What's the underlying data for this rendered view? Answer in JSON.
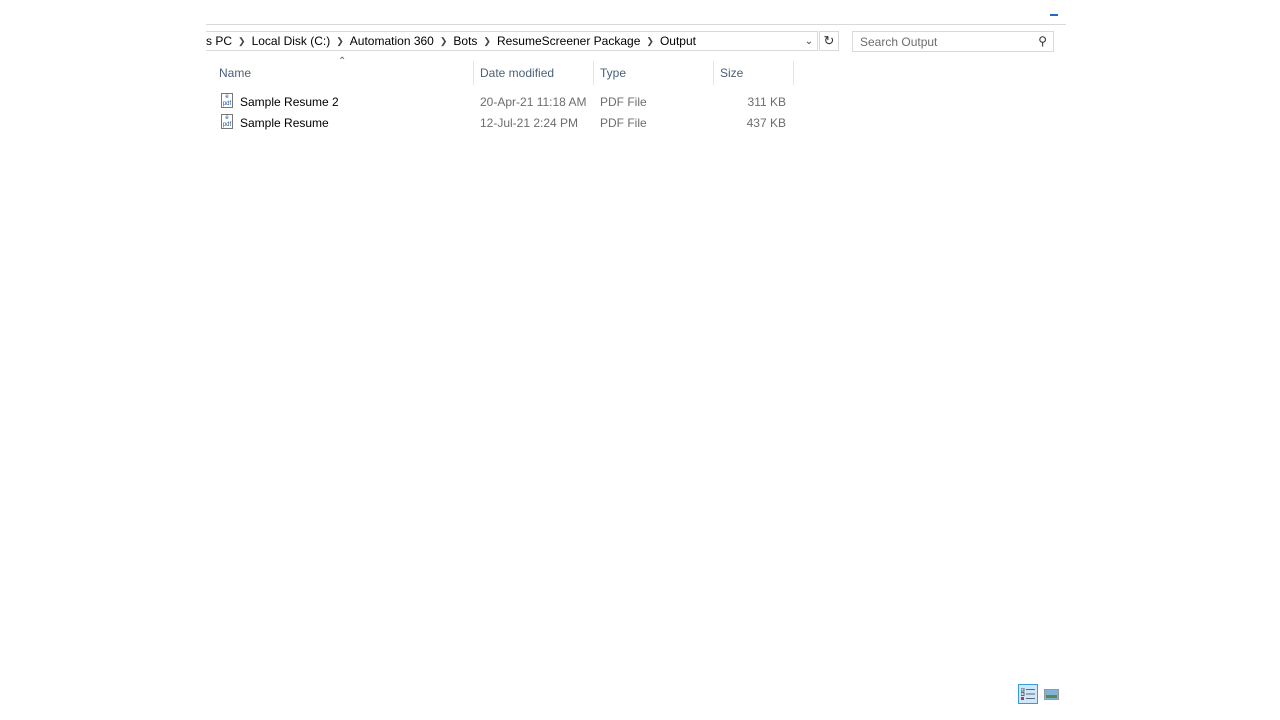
{
  "breadcrumb": [
    "s PC",
    "Local Disk (C:)",
    "Automation 360",
    "Bots",
    "ResumeScreener Package",
    "Output"
  ],
  "search": {
    "placeholder": "Search Output"
  },
  "columns": {
    "name": "Name",
    "date": "Date modified",
    "type": "Type",
    "size": "Size"
  },
  "files": [
    {
      "name": "Sample Resume 2",
      "date": "20-Apr-21 11:18 AM",
      "type": "PDF File",
      "size": "311 KB"
    },
    {
      "name": "Sample Resume",
      "date": "12-Jul-21 2:24 PM",
      "type": "PDF File",
      "size": "437 KB"
    }
  ]
}
